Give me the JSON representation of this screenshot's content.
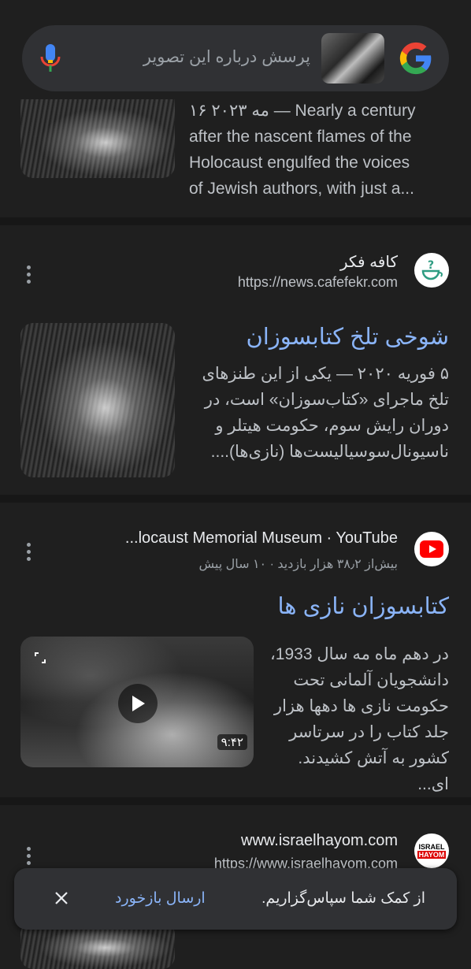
{
  "search": {
    "placeholder": "پرسش درباره این تصویر"
  },
  "results": [
    {
      "snippet_lines": [
        "۱۶ مه ۲۰۲۳ — Nearly a century",
        "after the nascent flames of the",
        "Holocaust engulfed the voices",
        "of Jewish authors, with just a..."
      ]
    },
    {
      "site_name": "کافه فکر",
      "url": "https://news.cafefekr.com",
      "title": "شوخی تلخ کتابسوزان",
      "snippet_lines": [
        "۵ فوریه ۲۰۲۰ — یکی از این طنزهای",
        "تلخ ماجرای «کتاب‌سوزان» است، در",
        "دوران رایش سوم، حکومت هیتلر و",
        "ناسیونال‌سوسیالیست‌ها (نازی‌ها)...."
      ]
    },
    {
      "site_name": "...locaust Memorial Museum · YouTube",
      "meta": "بیش‌از ۳۸٫۲ هزار بازدید · ۱۰ سال پیش",
      "title": "کتابسوزان نازی ها",
      "snippet_lines": [
        "در دهم ماه مه سال 1933،",
        "دانشجویان آلمانی تحت",
        "حکومت نازی ها دهها هزار",
        "جلد کتاب را در سرتاسر",
        "کشور به آتش کشیدند. ای..."
      ],
      "duration": "۹:۴۲"
    },
    {
      "site_name": "www.israelhayom.com",
      "url": "https://www.israelhayom.com",
      "favicon_text": [
        "ISRAEL",
        "HAYOM"
      ]
    }
  ],
  "snackbar": {
    "message": "از کمک شما سپاس‌گزاریم.",
    "action": "ارسال بازخورد"
  },
  "colors": {
    "background": "#1f1f1f",
    "link": "#8ab4f8",
    "surface": "#303134"
  }
}
